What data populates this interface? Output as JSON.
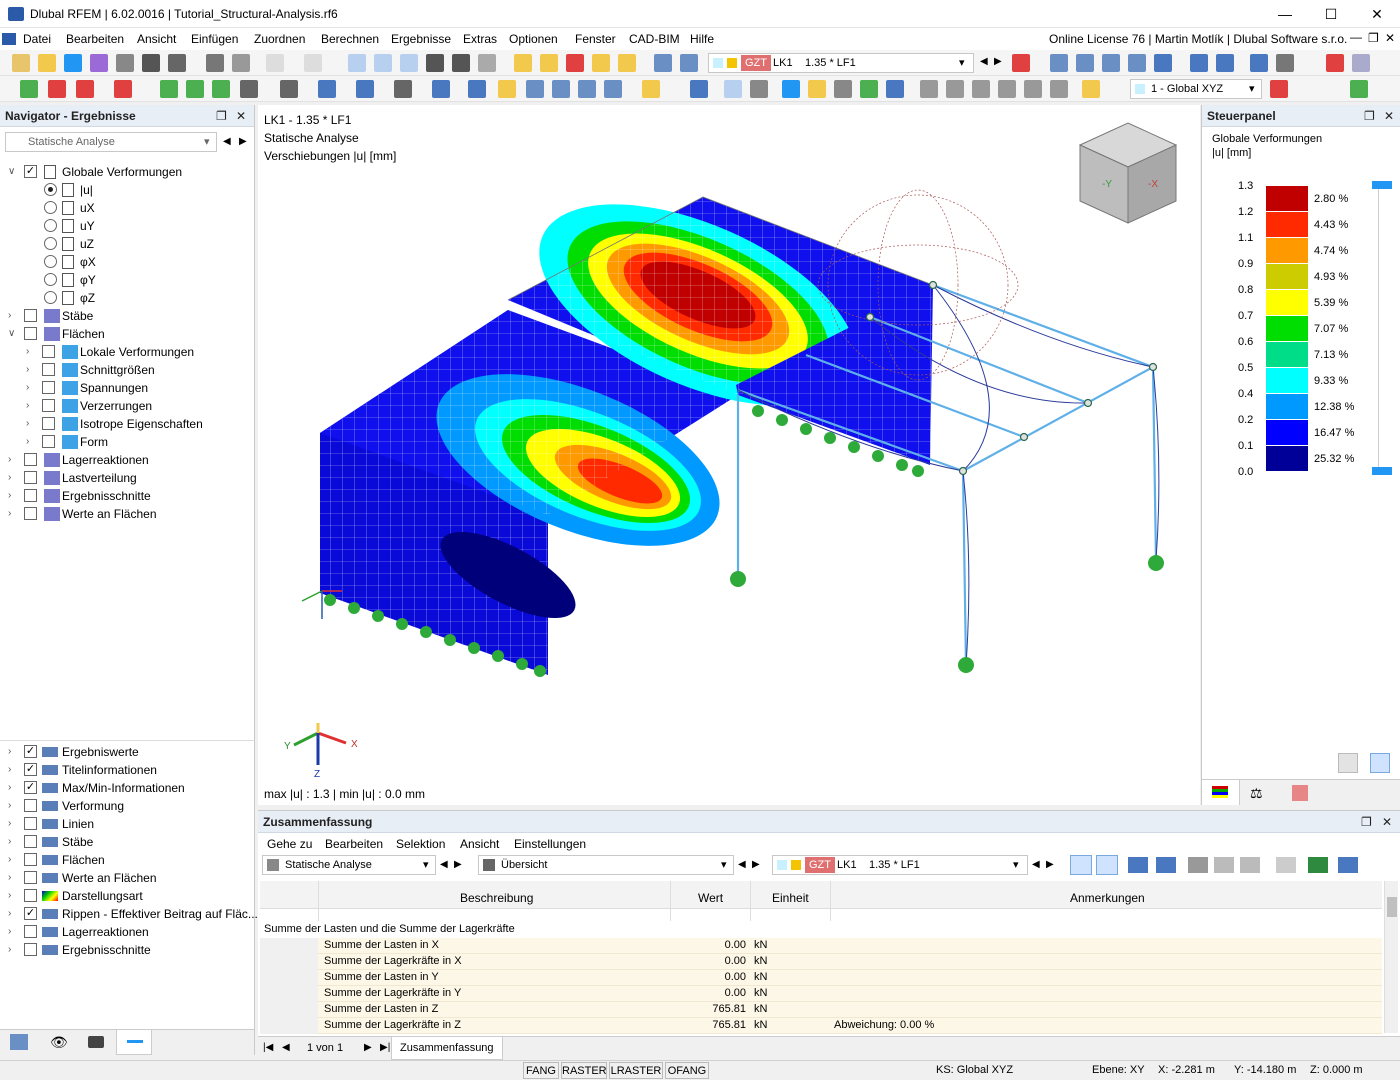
{
  "window": {
    "title": "Dlubal RFEM | 6.02.0016 | Tutorial_Structural-Analysis.rf6",
    "license": "Online License 76 | Martin Motlík | Dlubal Software s.r.o."
  },
  "menu": [
    "Datei",
    "Bearbeiten",
    "Ansicht",
    "Einfügen",
    "Zuordnen",
    "Berechnen",
    "Ergebnisse",
    "Extras",
    "Optionen",
    "Fenster",
    "CAD-BIM",
    "Hilfe"
  ],
  "toolbar": {
    "load_type": "GZT",
    "load_case": "LK1",
    "load_combo": "1.35 * LF1",
    "coord_system": "1 - Global XYZ"
  },
  "navigator": {
    "title": "Navigator - Ergebnisse",
    "analysis": "Statische Analyse",
    "top_items": [
      {
        "label": "Globale Verformungen",
        "level": 0,
        "checked": true,
        "expanded": true
      },
      {
        "label": "|u|",
        "level": 1,
        "radio": true,
        "on": true
      },
      {
        "label": "uX",
        "level": 1,
        "radio": true
      },
      {
        "label": "uY",
        "level": 1,
        "radio": true
      },
      {
        "label": "uZ",
        "level": 1,
        "radio": true
      },
      {
        "label": "φX",
        "level": 1,
        "radio": true
      },
      {
        "label": "φY",
        "level": 1,
        "radio": true
      },
      {
        "label": "φZ",
        "level": 1,
        "radio": true
      },
      {
        "label": "Stäbe",
        "level": 0,
        "checked": false
      },
      {
        "label": "Flächen",
        "level": 0,
        "checked": false,
        "expanded": true
      },
      {
        "label": "Lokale Verformungen",
        "level": 1,
        "checked": false
      },
      {
        "label": "Schnittgrößen",
        "level": 1,
        "checked": false
      },
      {
        "label": "Spannungen",
        "level": 1,
        "checked": false
      },
      {
        "label": "Verzerrungen",
        "level": 1,
        "checked": false
      },
      {
        "label": "Isotrope Eigenschaften",
        "level": 1,
        "checked": false
      },
      {
        "label": "Form",
        "level": 1,
        "checked": false
      },
      {
        "label": "Lagerreaktionen",
        "level": 0,
        "checked": false
      },
      {
        "label": "Lastverteilung",
        "level": 0,
        "checked": false
      },
      {
        "label": "Ergebnisschnitte",
        "level": 0,
        "checked": false
      },
      {
        "label": "Werte an Flächen",
        "level": 0,
        "checked": false
      }
    ],
    "bottom_items": [
      {
        "label": "Ergebniswerte",
        "checked": true
      },
      {
        "label": "Titelinformationen",
        "checked": true
      },
      {
        "label": "Max/Min-Informationen",
        "checked": true
      },
      {
        "label": "Verformung",
        "checked": false
      },
      {
        "label": "Linien",
        "checked": false
      },
      {
        "label": "Stäbe",
        "checked": false
      },
      {
        "label": "Flächen",
        "checked": false
      },
      {
        "label": "Werte an Flächen",
        "checked": false
      },
      {
        "label": "Darstellungsart",
        "checked": false
      },
      {
        "label": "Rippen - Effektiver Beitrag auf Fläc...",
        "checked": true
      },
      {
        "label": "Lagerreaktionen",
        "checked": false
      },
      {
        "label": "Ergebnisschnitte",
        "checked": false
      }
    ]
  },
  "viewport": {
    "line1": "LK1 - 1.35 * LF1",
    "line2": "Statische Analyse",
    "line3": "Verschiebungen |u| [mm]",
    "maxmin": "max |u| : 1.3 | min |u| : 0.0 mm",
    "axis_x": "X",
    "axis_y": "Y",
    "axis_z": "Z"
  },
  "control_panel": {
    "title": "Steuerpanel",
    "subtitle1": "Globale Verformungen",
    "subtitle2": "|u| [mm]",
    "legend": [
      {
        "value": "1.3",
        "color": "#c00000",
        "percent": "2.80 %"
      },
      {
        "value": "1.2",
        "color": "#ff2a00",
        "percent": "4.43 %"
      },
      {
        "value": "1.1",
        "color": "#ff9900",
        "percent": "4.74 %"
      },
      {
        "value": "0.9",
        "color": "#cccc00",
        "percent": "4.93 %"
      },
      {
        "value": "0.8",
        "color": "#ffff00",
        "percent": "5.39 %"
      },
      {
        "value": "0.7",
        "color": "#00dd00",
        "percent": "7.07 %"
      },
      {
        "value": "0.6",
        "color": "#00dd88",
        "percent": "7.13 %"
      },
      {
        "value": "0.5",
        "color": "#00ffff",
        "percent": "9.33 %"
      },
      {
        "value": "0.4",
        "color": "#0099ff",
        "percent": "12.38 %"
      },
      {
        "value": "0.2",
        "color": "#0000ff",
        "percent": "16.47 %"
      },
      {
        "value": "0.1",
        "color": "#000099",
        "percent": "25.32 %"
      },
      {
        "value": "0.0",
        "color": "",
        "percent": ""
      }
    ]
  },
  "summary": {
    "title": "Zusammenfassung",
    "menu": [
      "Gehe zu",
      "Bearbeiten",
      "Selektion",
      "Ansicht",
      "Einstellungen"
    ],
    "analysis": "Statische Analyse",
    "view": "Übersicht",
    "load_type": "GZT",
    "load_case": "LK1",
    "load_combo": "1.35 * LF1",
    "headers": {
      "desc": "Beschreibung",
      "value": "Wert",
      "unit": "Einheit",
      "notes": "Anmerkungen"
    },
    "group": "Summe der Lasten und die Summe der Lagerkräfte",
    "rows": [
      {
        "desc": "Summe der Lasten in X",
        "value": "0.00",
        "unit": "kN",
        "note": ""
      },
      {
        "desc": "Summe der Lagerkräfte in X",
        "value": "0.00",
        "unit": "kN",
        "note": ""
      },
      {
        "desc": "Summe der Lasten in Y",
        "value": "0.00",
        "unit": "kN",
        "note": ""
      },
      {
        "desc": "Summe der Lagerkräfte in Y",
        "value": "0.00",
        "unit": "kN",
        "note": ""
      },
      {
        "desc": "Summe der Lasten in Z",
        "value": "765.81",
        "unit": "kN",
        "note": ""
      },
      {
        "desc": "Summe der Lagerkräfte in Z",
        "value": "765.81",
        "unit": "kN",
        "note": "Abweichung: 0.00 %"
      }
    ],
    "pager": "1 von 1",
    "tab": "Zusammenfassung"
  },
  "statusbar": {
    "buttons": [
      "FANG",
      "RASTER",
      "LRASTER",
      "OFANG"
    ],
    "ks": "KS: Global XYZ",
    "plane": "Ebene: XY",
    "x": "X: -2.281 m",
    "y": "Y: -14.180 m",
    "z": "Z: 0.000 m"
  }
}
